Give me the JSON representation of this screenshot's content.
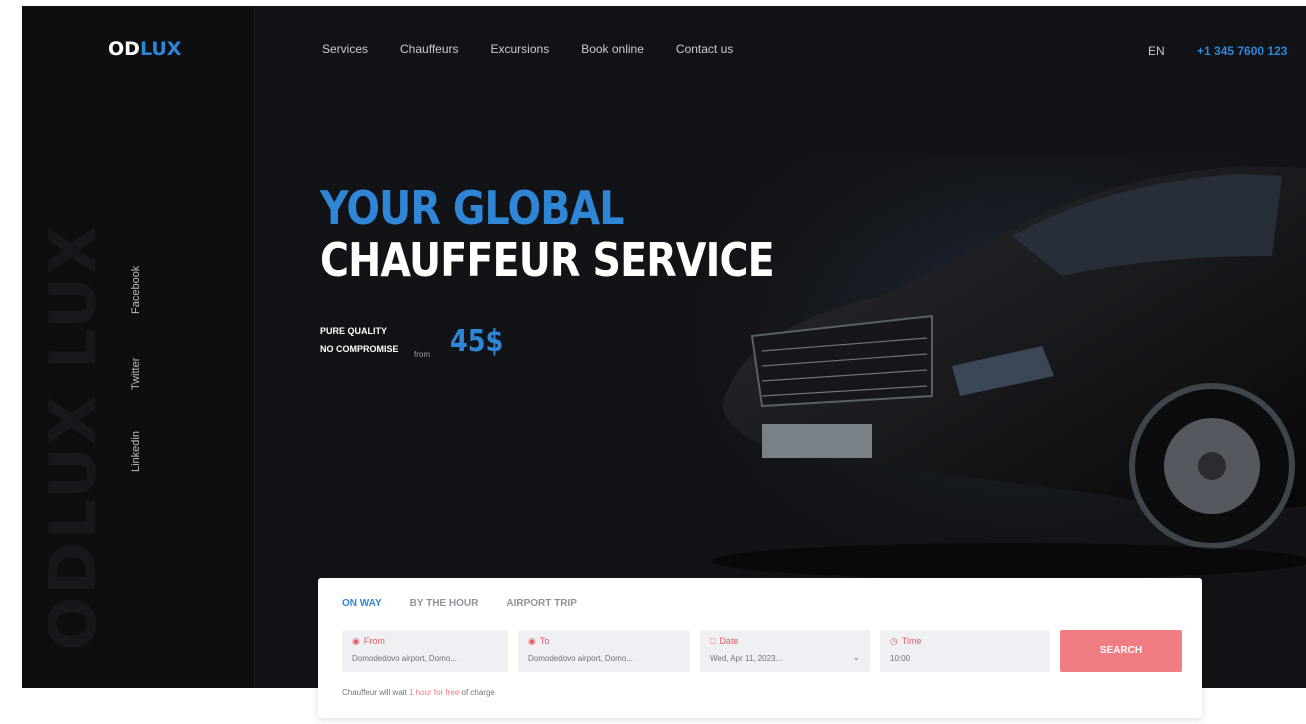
{
  "brand": {
    "part1": "OD",
    "part2": "LUX"
  },
  "watermark": "ODLUX LUX",
  "nav": [
    "Services",
    "Chauffeurs",
    "Excursions",
    "Book online",
    "Contact us"
  ],
  "lang": "EN",
  "phone": "+1 345 7600 123",
  "social": [
    "Facebook",
    "Twitter",
    "Linkedin"
  ],
  "hero": {
    "line1": "YOUR GLOBAL",
    "line2": "CHAUFFEUR SERVICE",
    "tag1": "PURE QUALITY",
    "tag2": "NO COMPROMISE",
    "from": "from",
    "price": "45$"
  },
  "booking": {
    "tabs": [
      "ON WAY",
      "BY THE HOUR",
      "AIRPORT TRIP"
    ],
    "from_label": "From",
    "from_value": "Domodedovo airport, Domo...",
    "to_label": "To",
    "to_value": "Domodedovo airport, Domo...",
    "date_label": "Date",
    "date_value": "Wed, Apr 11, 2023...",
    "time_label": "Time",
    "time_value": "10:00",
    "search": "SEARCH",
    "note_pre": "Chauffeur will wait",
    "note_hl": "1 hour for free",
    "note_post": "of charge"
  },
  "colors": {
    "accent": "#2f86d6",
    "cta": "#f07c84",
    "bg": "#121316"
  }
}
